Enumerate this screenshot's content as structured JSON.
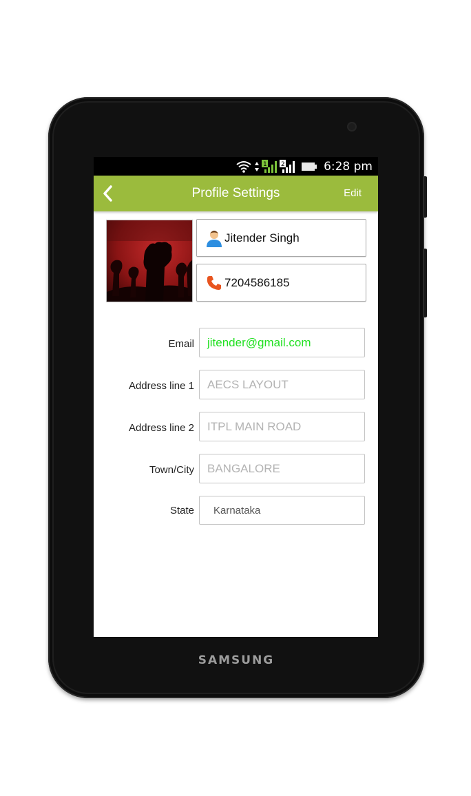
{
  "device": {
    "brand": "SAMSUNG"
  },
  "statusbar": {
    "time": "6:28 pm",
    "icons": [
      "wifi-icon",
      "sim1-signal-icon",
      "sim2-signal-icon",
      "battery-icon"
    ]
  },
  "appbar": {
    "title": "Profile Settings",
    "edit_label": "Edit",
    "back_icon": "chevron-left-icon"
  },
  "profile": {
    "name": "Jitender Singh",
    "phone": "7204586185",
    "name_icon": "person-icon",
    "phone_icon": "phone-icon"
  },
  "form": {
    "email_label": "Email",
    "email_value": "jitender@gmail.com",
    "address1_label": "Address line 1",
    "address1_value": "AECS LAYOUT",
    "address2_label": "Address line 2",
    "address2_value": "ITPL MAIN ROAD",
    "city_label": "Town/City",
    "city_value": "BANGALORE",
    "state_label": "State",
    "state_value": "Karnataka"
  },
  "colors": {
    "appbar": "#9bbb3d",
    "email_text": "#22e022",
    "placeholder_text": "#b3b3b3"
  }
}
